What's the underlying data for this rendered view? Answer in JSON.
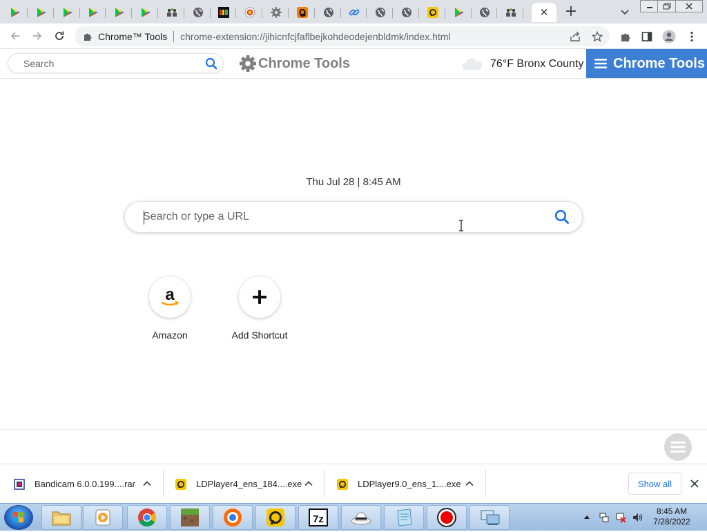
{
  "browser": {
    "tabs": [
      {
        "icon": "google-play-icon"
      },
      {
        "icon": "google-play-icon"
      },
      {
        "icon": "google-play-icon"
      },
      {
        "icon": "google-play-icon"
      },
      {
        "icon": "google-play-icon"
      },
      {
        "icon": "google-play-icon"
      },
      {
        "icon": "people-icon"
      },
      {
        "icon": "globe-icon"
      },
      {
        "icon": "colorful-grid-icon"
      },
      {
        "icon": "badge-icon"
      },
      {
        "icon": "gear-icon"
      },
      {
        "icon": "g-logo-icon"
      },
      {
        "icon": "globe-icon"
      },
      {
        "icon": "link-icon"
      },
      {
        "icon": "globe-icon"
      },
      {
        "icon": "globe-icon"
      },
      {
        "icon": "ldplayer-icon"
      },
      {
        "icon": "google-play-icon"
      },
      {
        "icon": "globe-icon"
      },
      {
        "icon": "people-icon"
      }
    ],
    "active_tab_close": "✕",
    "new_tab": "+",
    "omnibox": {
      "origin": "Chrome™ Tools",
      "url": "chrome-extension://jihicnfcjfaflbejkohdeodejenbldmk/index.html"
    }
  },
  "header": {
    "search_placeholder": "Search",
    "brand": "Chrome Tools",
    "weather": "76°F Bronx County",
    "menu_label": "Chrome Tools"
  },
  "main": {
    "datetime": "Thu Jul 28 | 8:45 AM",
    "search_placeholder": "Search or type a URL",
    "shortcuts": [
      {
        "label": "Amazon"
      },
      {
        "label": "Add Shortcut"
      }
    ]
  },
  "downloads": {
    "items": [
      {
        "name": "Bandicam 6.0.0.199....rar"
      },
      {
        "name": "LDPlayer4_ens_184....exe"
      },
      {
        "name": "LDPlayer9.0_ens_1....exe"
      }
    ],
    "show_all": "Show all"
  },
  "taskbar": {
    "apps": [
      "file-explorer-icon",
      "media-player-icon",
      "chrome-icon",
      "minecraft-icon",
      "browser-icon",
      "ldplayer-icon",
      "7zip-icon",
      "hat-icon",
      "notepad-icon",
      "recorder-icon",
      "network-icon"
    ],
    "time": "8:45 AM",
    "date": "7/28/2022"
  },
  "colors": {
    "accent": "#3d7fd5",
    "search_icon": "#1a73e8",
    "tabstrip": "#dee1e6"
  }
}
